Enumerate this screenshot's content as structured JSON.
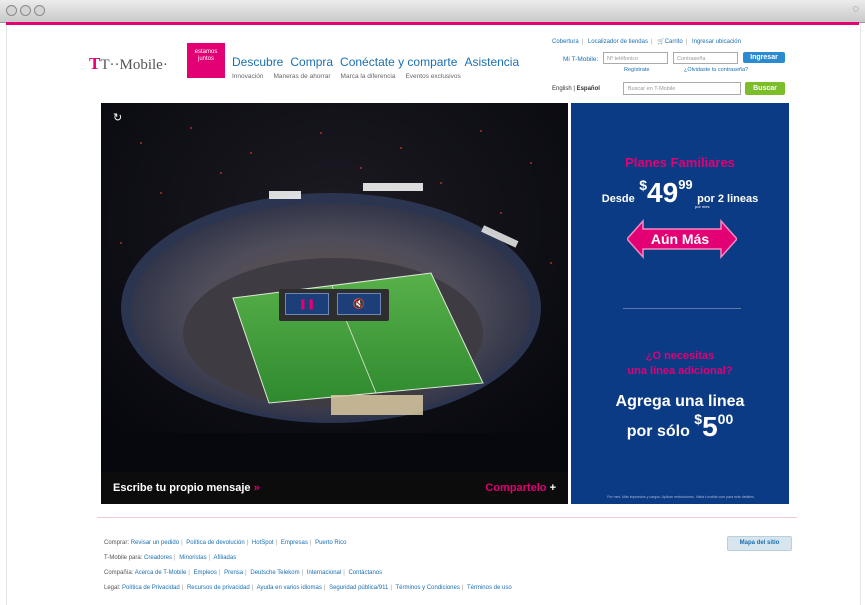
{
  "header": {
    "logo_text": "T··Mobile·",
    "badge_text": "estamos juntos",
    "nav": [
      "Descubre",
      "Compra",
      "Conéctate y comparte",
      "Asistencia"
    ],
    "subnav": [
      "Innovación",
      "Maneras de ahorrar",
      "Marca la diferencia",
      "Eventos exclusivos"
    ],
    "util_links": [
      "Cobertura",
      "Localizador de tiendas",
      "Carrito",
      "Ingresar ubicación"
    ],
    "account_label": "Mi T-Mobile:",
    "phone_placeholder": "Nº teléfonico",
    "password_placeholder": "Contraseña",
    "login_button": "Ingresar",
    "register_link": "Regístrate",
    "forgot_link": "¿Olvidaste tu contraseña?",
    "lang_english": "English",
    "lang_spanish": "Español",
    "search_placeholder": "Buscar en T-Mobile",
    "search_button": "Buscar"
  },
  "hero": {
    "reload_icon": "reload-icon",
    "pause_icon": "pause-icon",
    "mute_icon": "mute-icon",
    "caption_left": "Escribe tu propio mensaje",
    "caption_left_arrows": "»",
    "caption_right": "Compartelo",
    "caption_right_plus": "+"
  },
  "promo": {
    "title": "Planes Familiares",
    "desde": "Desde",
    "price_dollar": "$",
    "price_main": "49",
    "price_cents": "99",
    "per_month": "por mes",
    "lines": "por 2 lineas",
    "banner": "Aún Más",
    "question_1": "¿O necesitas",
    "question_2": "una línea adicional?",
    "add_line_1": "Agrega una linea",
    "add_line_2": "por sólo",
    "add_price_dollar": "$",
    "add_price_main": "5",
    "add_price_cents": "00",
    "fine_print": "Por mes. Más impuestos y cargos. Aplican restricciones. Visita t-mobile.com para más detalles."
  },
  "footer": {
    "comprar_label": "Comprar:",
    "comprar_links": [
      "Revisar un pedido",
      "Política de devolución",
      "HotSpot",
      "Empresas",
      "Puerto Rico"
    ],
    "tmobile_label": "T-Mobile para:",
    "tmobile_links": [
      "Creadores",
      "Minoristas",
      "Afiliadas"
    ],
    "compania_label": "Compañía:",
    "compania_links": [
      "Acerca de T-Mobile",
      "Empleos",
      "Prensa",
      "Deutsche Telekom",
      "Internacional",
      "Contáctanos"
    ],
    "legal_label": "Legal:",
    "legal_links": [
      "Política de Privacidad",
      "Recursos de privacidad",
      "Ayuda en varios idiomas",
      "Seguridad pública/911",
      "Términos y Condiciones",
      "Términos de uso"
    ],
    "sitemap_button": "Mapa del sitio"
  },
  "colors": {
    "magenta": "#e20074",
    "promo_blue": "#0c3b85",
    "link_blue": "#1a6fb3",
    "green_button": "#7cbd2a"
  }
}
